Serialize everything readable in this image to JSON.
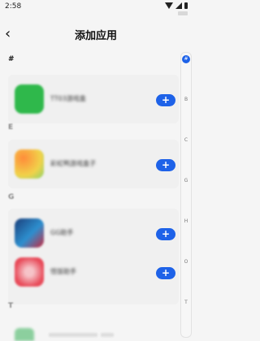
{
  "status_bar": {
    "time": "2:58"
  },
  "header": {
    "back_icon": "‹",
    "title": "添加应用"
  },
  "sections": [
    {
      "letter": "#"
    },
    {
      "letter": "E"
    },
    {
      "letter": "G"
    },
    {
      "letter": "T"
    }
  ],
  "apps": [
    {
      "name": "TT03游戏盒",
      "icon_color": "#2fb84b"
    },
    {
      "name": "彩虹鸭游戏盒子",
      "icon_color": "#f1b33f"
    },
    {
      "name": "GG助手",
      "icon_color": "#1e73b8"
    },
    {
      "name": "悟饭助手",
      "icon_color": "#e84b5a"
    }
  ],
  "add_button": {
    "label": "+"
  },
  "index": {
    "active": "#",
    "letters": [
      "B",
      "C",
      "G",
      "H",
      "O",
      "T"
    ]
  }
}
